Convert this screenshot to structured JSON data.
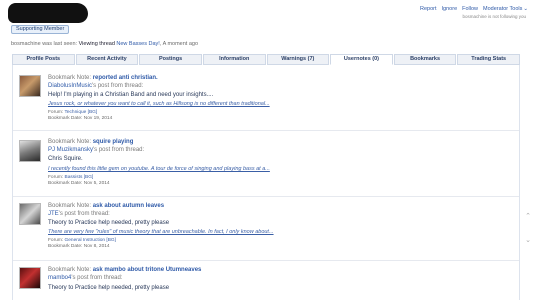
{
  "header": {
    "support_label": "Supporting Member",
    "last_seen_user": "bosmachine",
    "last_seen_mid": " was last seen: ",
    "last_seen_action": "Viewing thread ",
    "last_seen_thread": "New Basses Day!",
    "last_seen_time": ", A moment ago",
    "top_links": [
      "Report",
      "Ignore",
      "Follow",
      "Moderator Tools"
    ],
    "not_following": "bosmachine is not following you"
  },
  "tabs": [
    {
      "label": "Profile Posts",
      "active": false
    },
    {
      "label": "Recent Activity",
      "active": false
    },
    {
      "label": "Postings",
      "active": false
    },
    {
      "label": "Information",
      "active": false
    },
    {
      "label": "Warnings (7)",
      "active": false
    },
    {
      "label": "Usernotes (0)",
      "active": true
    },
    {
      "label": "Bookmarks",
      "active": false
    },
    {
      "label": "Trading Stats",
      "active": false
    }
  ],
  "bookmarks": [
    {
      "label": "Bookmark Note: ",
      "title": "reported anti christian.",
      "poster": "DiabolusInMusic",
      "poster_suffix": "'s post from thread:",
      "thread": "Help! I'm playing in a Christian Band and need your insights....",
      "quote": "Jesus rock, or whatever you want to call it, such as Hillsong is no different than traditional...",
      "forum_label": "Forum: ",
      "forum": "Technique [BG]",
      "date_label": "Bookmark Date: ",
      "date": "Nov 19, 2014"
    },
    {
      "label": "Bookmark Note: ",
      "title": "squire playing",
      "poster": "PJ Muzikmansky",
      "poster_suffix": "'s post from thread:",
      "thread": "Chris Squire.",
      "quote": "I recently found this little gem on youtube. A tour de force of singing and playing bass at a...",
      "forum_label": "Forum: ",
      "forum": "Bassists [BG]",
      "date_label": "Bookmark Date: ",
      "date": "Nov 5, 2014"
    },
    {
      "label": "Bookmark Note: ",
      "title": "ask about autumn leaves",
      "poster": "JTE",
      "poster_suffix": "'s post from thread:",
      "thread": "Theory to Practice help needed, pretty please",
      "quote": "There are very few \"rules\" of music theory that are unbreachable. In fact, I only know about...",
      "forum_label": "Forum: ",
      "forum": "General Instruction [BG]",
      "date_label": "Bookmark Date: ",
      "date": "Nov 8, 2014"
    },
    {
      "label": "Bookmark Note: ",
      "title": "ask mambo about tritone Utumneaves",
      "poster": "mambo4",
      "poster_suffix": "'s post from thread:",
      "thread": "Theory to Practice help needed, pretty please",
      "quote": "",
      "forum_label": "",
      "forum": "",
      "date_label": "",
      "date": ""
    }
  ]
}
